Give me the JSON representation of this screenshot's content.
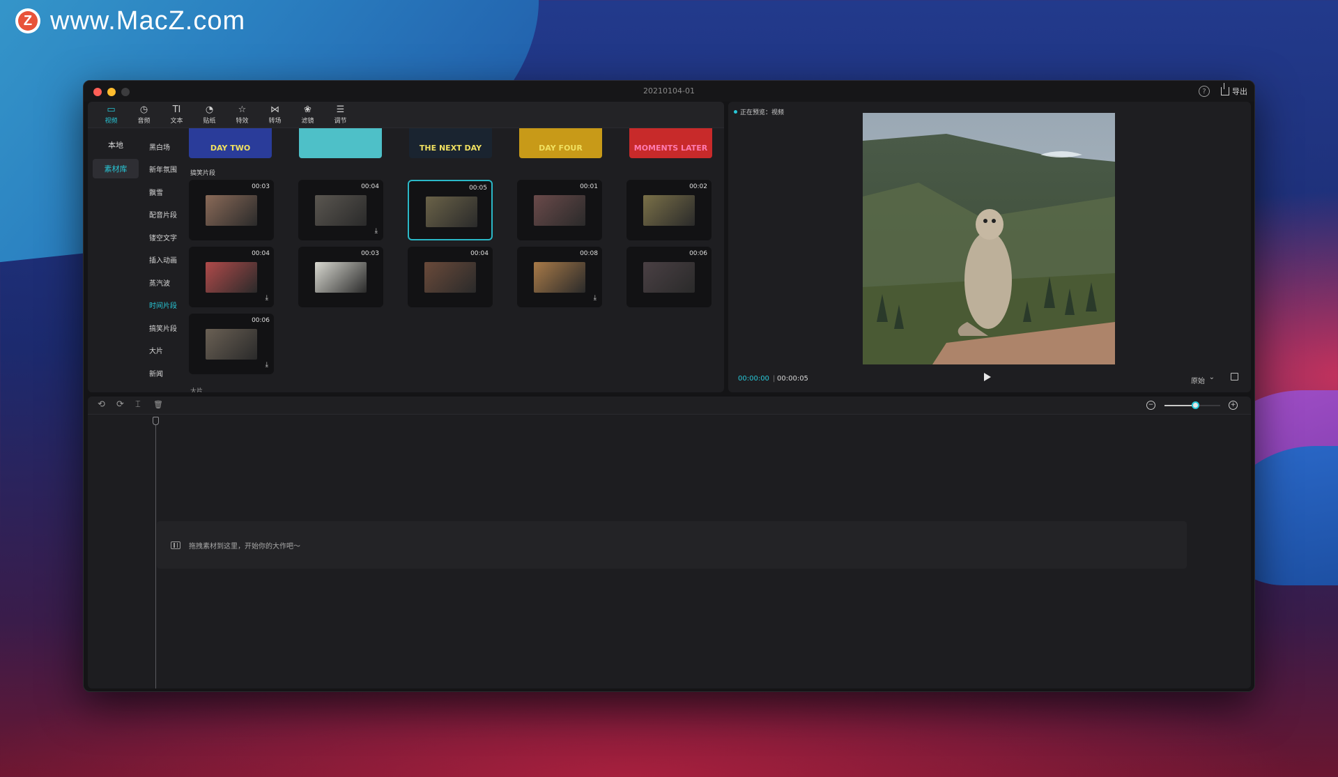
{
  "watermark": {
    "logo_letter": "Z",
    "text": "www.MacZ.com"
  },
  "window": {
    "title": "20210104-01",
    "help_label": "?",
    "export_label": "导出"
  },
  "toolbar": {
    "items": [
      {
        "icon": "video-icon",
        "glyph": "▭",
        "label": "视频",
        "active": true
      },
      {
        "icon": "audio-icon",
        "glyph": "◷",
        "label": "音频"
      },
      {
        "icon": "text-icon",
        "glyph": "TI",
        "label": "文本"
      },
      {
        "icon": "sticker-icon",
        "glyph": "◔",
        "label": "贴纸"
      },
      {
        "icon": "effects-icon",
        "glyph": "☆",
        "label": "特效"
      },
      {
        "icon": "transition-icon",
        "glyph": "⋈",
        "label": "转场"
      },
      {
        "icon": "filter-icon",
        "glyph": "❀",
        "label": "滤镜"
      },
      {
        "icon": "adjust-icon",
        "glyph": "☰",
        "label": "调节"
      }
    ]
  },
  "sidebar": {
    "tabs": [
      {
        "label": "本地"
      },
      {
        "label": "素材库",
        "active": true
      }
    ]
  },
  "categories": [
    {
      "label": "黑白场"
    },
    {
      "label": "新年氛围"
    },
    {
      "label": "飘雪"
    },
    {
      "label": "配音片段"
    },
    {
      "label": "镂空文字"
    },
    {
      "label": "插入动画"
    },
    {
      "label": "蒸汽波"
    },
    {
      "label": "时间片段",
      "active": true
    },
    {
      "label": "搞笑片段"
    },
    {
      "label": "大片"
    },
    {
      "label": "新闻"
    }
  ],
  "top_strip": [
    {
      "caption": "DAY TWO",
      "color": "#2a3c9a"
    },
    {
      "caption": "",
      "color": "#4ec0c8"
    },
    {
      "caption": "THE NEXT DAY",
      "color": "#1a2430"
    },
    {
      "caption": "DAY FOUR",
      "color": "#c89a18"
    },
    {
      "caption": "MOMENTS LATER",
      "color": "#c82a2a"
    }
  ],
  "section_label": "搞笑片段",
  "clips": [
    {
      "duration": "00:03",
      "thumb_color": "#8a6a58"
    },
    {
      "duration": "00:04",
      "thumb_color": "#5a5650",
      "download": true
    },
    {
      "duration": "00:05",
      "thumb_color": "#6a6248",
      "selected": true
    },
    {
      "duration": "00:01",
      "thumb_color": "#6a4a4a"
    },
    {
      "duration": "00:02",
      "thumb_color": "#7a7048"
    },
    {
      "duration": "00:04",
      "thumb_color": "#b04a4a",
      "download": true
    },
    {
      "duration": "00:03",
      "thumb_color": "#d8d8d0"
    },
    {
      "duration": "00:04",
      "thumb_color": "#6a4a3a"
    },
    {
      "duration": "00:08",
      "thumb_color": "#a87a48",
      "download": true
    },
    {
      "duration": "00:06",
      "thumb_color": "#4a4044"
    },
    {
      "duration": "00:06",
      "thumb_color": "#6a6054",
      "download": true
    }
  ],
  "more_label": "大片",
  "preview": {
    "label": "正在预览：视频",
    "time_current": "00:00:00",
    "time_separator": "|",
    "time_total": "00:00:05",
    "ratio_label": "原始"
  },
  "timeline": {
    "undo_icon": "⟲",
    "redo_icon": "⟳",
    "split_icon": "⌶",
    "delete_icon": "🗑",
    "zoom_out_glyph": "−",
    "zoom_in_glyph": "+",
    "zoom_level": 0.55,
    "drop_hint": "拖拽素材到这里，开始你的大作吧～"
  },
  "colors": {
    "accent": "#28c8d8",
    "panel": "#1e1e21",
    "window": "#141416"
  }
}
